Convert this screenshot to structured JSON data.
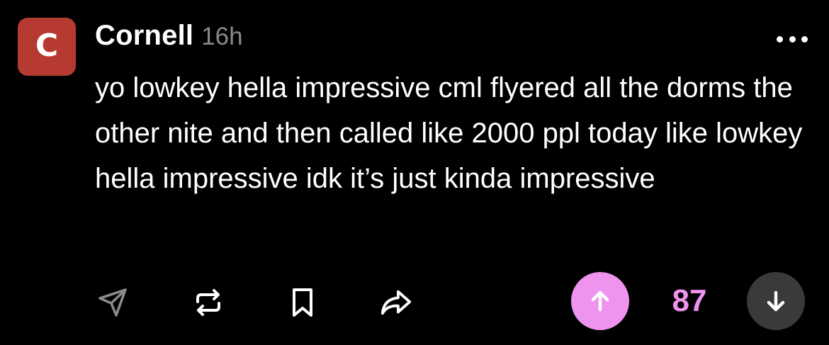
{
  "post": {
    "avatar_letter": "C",
    "author": "Cornell",
    "time": "16h",
    "text": "yo lowkey hella impressive cml flyered all the dorms the other nite and then called like 2000 ppl today like lowkey hella impressive idk it’s just kinda impressive",
    "score": "87"
  },
  "icons": {
    "more": "more-options-icon",
    "send": "send-icon",
    "repost": "repost-icon",
    "bookmark": "bookmark-icon",
    "share": "share-icon",
    "upvote": "arrow-up-icon",
    "downvote": "arrow-down-icon"
  },
  "colors": {
    "background": "#000000",
    "avatar": "#b73a32",
    "accent": "#ee93ee",
    "muted": "#8a8a8a",
    "downvote_bg": "#3a3a3a"
  }
}
